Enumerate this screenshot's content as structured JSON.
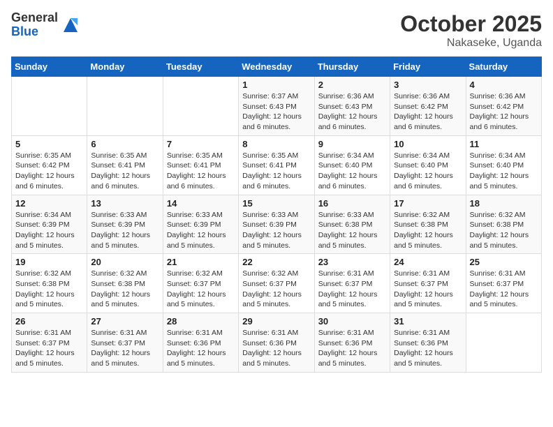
{
  "logo": {
    "general": "General",
    "blue": "Blue"
  },
  "title": "October 2025",
  "location": "Nakaseke, Uganda",
  "days_header": [
    "Sunday",
    "Monday",
    "Tuesday",
    "Wednesday",
    "Thursday",
    "Friday",
    "Saturday"
  ],
  "weeks": [
    [
      {
        "day": "",
        "info": ""
      },
      {
        "day": "",
        "info": ""
      },
      {
        "day": "",
        "info": ""
      },
      {
        "day": "1",
        "info": "Sunrise: 6:37 AM\nSunset: 6:43 PM\nDaylight: 12 hours\nand 6 minutes."
      },
      {
        "day": "2",
        "info": "Sunrise: 6:36 AM\nSunset: 6:43 PM\nDaylight: 12 hours\nand 6 minutes."
      },
      {
        "day": "3",
        "info": "Sunrise: 6:36 AM\nSunset: 6:42 PM\nDaylight: 12 hours\nand 6 minutes."
      },
      {
        "day": "4",
        "info": "Sunrise: 6:36 AM\nSunset: 6:42 PM\nDaylight: 12 hours\nand 6 minutes."
      }
    ],
    [
      {
        "day": "5",
        "info": "Sunrise: 6:35 AM\nSunset: 6:42 PM\nDaylight: 12 hours\nand 6 minutes."
      },
      {
        "day": "6",
        "info": "Sunrise: 6:35 AM\nSunset: 6:41 PM\nDaylight: 12 hours\nand 6 minutes."
      },
      {
        "day": "7",
        "info": "Sunrise: 6:35 AM\nSunset: 6:41 PM\nDaylight: 12 hours\nand 6 minutes."
      },
      {
        "day": "8",
        "info": "Sunrise: 6:35 AM\nSunset: 6:41 PM\nDaylight: 12 hours\nand 6 minutes."
      },
      {
        "day": "9",
        "info": "Sunrise: 6:34 AM\nSunset: 6:40 PM\nDaylight: 12 hours\nand 6 minutes."
      },
      {
        "day": "10",
        "info": "Sunrise: 6:34 AM\nSunset: 6:40 PM\nDaylight: 12 hours\nand 6 minutes."
      },
      {
        "day": "11",
        "info": "Sunrise: 6:34 AM\nSunset: 6:40 PM\nDaylight: 12 hours\nand 5 minutes."
      }
    ],
    [
      {
        "day": "12",
        "info": "Sunrise: 6:34 AM\nSunset: 6:39 PM\nDaylight: 12 hours\nand 5 minutes."
      },
      {
        "day": "13",
        "info": "Sunrise: 6:33 AM\nSunset: 6:39 PM\nDaylight: 12 hours\nand 5 minutes."
      },
      {
        "day": "14",
        "info": "Sunrise: 6:33 AM\nSunset: 6:39 PM\nDaylight: 12 hours\nand 5 minutes."
      },
      {
        "day": "15",
        "info": "Sunrise: 6:33 AM\nSunset: 6:39 PM\nDaylight: 12 hours\nand 5 minutes."
      },
      {
        "day": "16",
        "info": "Sunrise: 6:33 AM\nSunset: 6:38 PM\nDaylight: 12 hours\nand 5 minutes."
      },
      {
        "day": "17",
        "info": "Sunrise: 6:32 AM\nSunset: 6:38 PM\nDaylight: 12 hours\nand 5 minutes."
      },
      {
        "day": "18",
        "info": "Sunrise: 6:32 AM\nSunset: 6:38 PM\nDaylight: 12 hours\nand 5 minutes."
      }
    ],
    [
      {
        "day": "19",
        "info": "Sunrise: 6:32 AM\nSunset: 6:38 PM\nDaylight: 12 hours\nand 5 minutes."
      },
      {
        "day": "20",
        "info": "Sunrise: 6:32 AM\nSunset: 6:38 PM\nDaylight: 12 hours\nand 5 minutes."
      },
      {
        "day": "21",
        "info": "Sunrise: 6:32 AM\nSunset: 6:37 PM\nDaylight: 12 hours\nand 5 minutes."
      },
      {
        "day": "22",
        "info": "Sunrise: 6:32 AM\nSunset: 6:37 PM\nDaylight: 12 hours\nand 5 minutes."
      },
      {
        "day": "23",
        "info": "Sunrise: 6:31 AM\nSunset: 6:37 PM\nDaylight: 12 hours\nand 5 minutes."
      },
      {
        "day": "24",
        "info": "Sunrise: 6:31 AM\nSunset: 6:37 PM\nDaylight: 12 hours\nand 5 minutes."
      },
      {
        "day": "25",
        "info": "Sunrise: 6:31 AM\nSunset: 6:37 PM\nDaylight: 12 hours\nand 5 minutes."
      }
    ],
    [
      {
        "day": "26",
        "info": "Sunrise: 6:31 AM\nSunset: 6:37 PM\nDaylight: 12 hours\nand 5 minutes."
      },
      {
        "day": "27",
        "info": "Sunrise: 6:31 AM\nSunset: 6:37 PM\nDaylight: 12 hours\nand 5 minutes."
      },
      {
        "day": "28",
        "info": "Sunrise: 6:31 AM\nSunset: 6:36 PM\nDaylight: 12 hours\nand 5 minutes."
      },
      {
        "day": "29",
        "info": "Sunrise: 6:31 AM\nSunset: 6:36 PM\nDaylight: 12 hours\nand 5 minutes."
      },
      {
        "day": "30",
        "info": "Sunrise: 6:31 AM\nSunset: 6:36 PM\nDaylight: 12 hours\nand 5 minutes."
      },
      {
        "day": "31",
        "info": "Sunrise: 6:31 AM\nSunset: 6:36 PM\nDaylight: 12 hours\nand 5 minutes."
      },
      {
        "day": "",
        "info": ""
      }
    ]
  ]
}
